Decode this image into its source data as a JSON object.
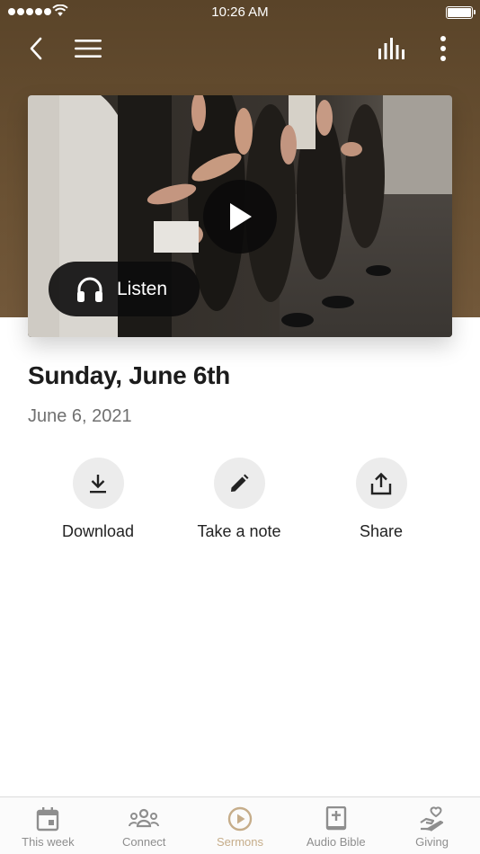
{
  "status_bar": {
    "time": "10:26 AM"
  },
  "media": {
    "listen_label": "Listen"
  },
  "sermon": {
    "title": "Sunday, June 6th",
    "date": "June 6, 2021"
  },
  "actions": [
    {
      "label": "Download",
      "icon": "download-icon"
    },
    {
      "label": "Take a note",
      "icon": "pencil-icon"
    },
    {
      "label": "Share",
      "icon": "share-icon"
    }
  ],
  "tabs": [
    {
      "label": "This week",
      "icon": "calendar-icon",
      "active": false
    },
    {
      "label": "Connect",
      "icon": "people-icon",
      "active": false
    },
    {
      "label": "Sermons",
      "icon": "play-circle-icon",
      "active": true
    },
    {
      "label": "Audio Bible",
      "icon": "bible-icon",
      "active": false
    },
    {
      "label": "Giving",
      "icon": "giving-hand-icon",
      "active": false
    }
  ],
  "colors": {
    "header_brown": "#6a5133",
    "active_tab": "#c6ad8a",
    "inactive_tab": "#8e8e8e"
  }
}
